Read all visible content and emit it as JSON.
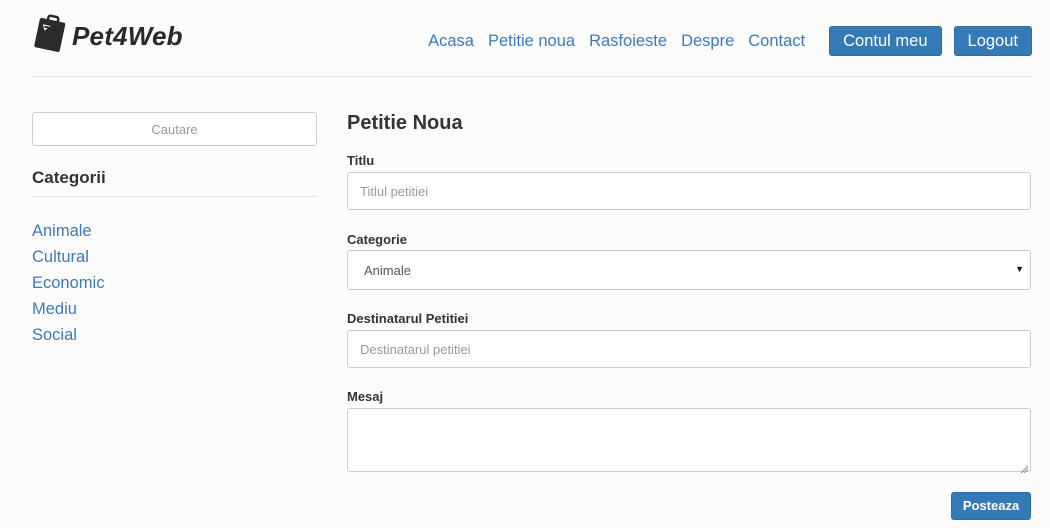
{
  "brand": {
    "name": "Pet4Web",
    "icon": "pet-tag-logo-icon"
  },
  "nav": {
    "links": [
      "Acasa",
      "Petitie noua",
      "Rasfoieste",
      "Despre",
      "Contact"
    ],
    "account_button": "Contul meu",
    "logout_button": "Logout"
  },
  "sidebar": {
    "search_placeholder": "Cautare",
    "categories_heading": "Categorii",
    "categories": [
      "Animale",
      "Cultural",
      "Economic",
      "Mediu",
      "Social"
    ]
  },
  "form": {
    "heading": "Petitie Noua",
    "title_label": "Titlu",
    "title_placeholder": "Titlul petitiei",
    "category_label": "Categorie",
    "category_value": "Animale",
    "recipient_label": "Destinatarul Petitiei",
    "recipient_placeholder": "Destinatarul petitiei",
    "message_label": "Mesaj",
    "submit_label": "Posteaza"
  },
  "colors": {
    "link": "#3e7ab8",
    "primary_button": "#337ab7",
    "background": "#fcfcfc"
  }
}
